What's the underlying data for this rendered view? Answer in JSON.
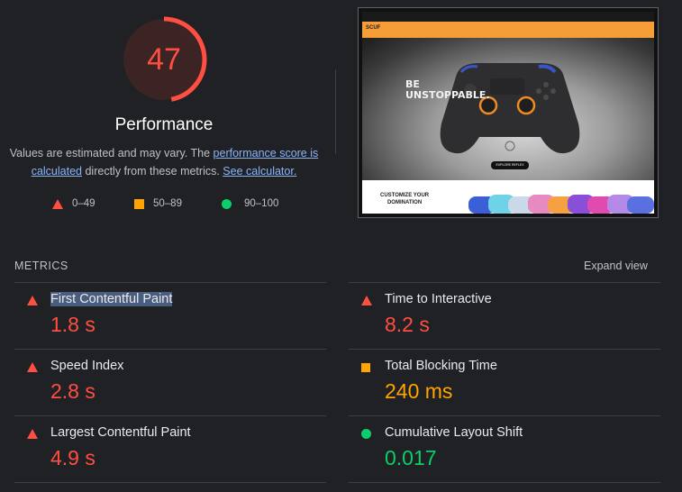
{
  "score": {
    "value": "47",
    "fraction": 0.47,
    "color": "#ff4e42",
    "title": "Performance"
  },
  "description": {
    "part1": "Values are estimated and may vary. The ",
    "link1": "performance score is calculated",
    "part2": " directly from these metrics. ",
    "link2": "See calculator."
  },
  "legend": [
    {
      "range": "0–49",
      "icon": "red-triangle-icon",
      "color": "#ff4e42"
    },
    {
      "range": "50–89",
      "icon": "orange-square-icon",
      "color": "#ffa400"
    },
    {
      "range": "90–100",
      "icon": "green-circle-icon",
      "color": "#0cce6b"
    }
  ],
  "thumbnail": {
    "logo": "SCUF",
    "headline_line1": "BE",
    "headline_line2": "UNSTOPPABLE.",
    "button": "EXPLORE REFLEX",
    "section_line1": "CUSTOMIZE YOUR",
    "section_line2": "DOMINATION"
  },
  "metrics": {
    "heading": "METRICS",
    "expand_label": "Expand view",
    "items": [
      {
        "label": "First Contentful Paint",
        "value": "1.8 s",
        "rating": "red"
      },
      {
        "label": "Time to Interactive",
        "value": "8.2 s",
        "rating": "red"
      },
      {
        "label": "Speed Index",
        "value": "2.8 s",
        "rating": "red"
      },
      {
        "label": "Total Blocking Time",
        "value": "240 ms",
        "rating": "orange"
      },
      {
        "label": "Largest Contentful Paint",
        "value": "4.9 s",
        "rating": "red"
      },
      {
        "label": "Cumulative Layout Shift",
        "value": "0.017",
        "rating": "green"
      }
    ]
  }
}
